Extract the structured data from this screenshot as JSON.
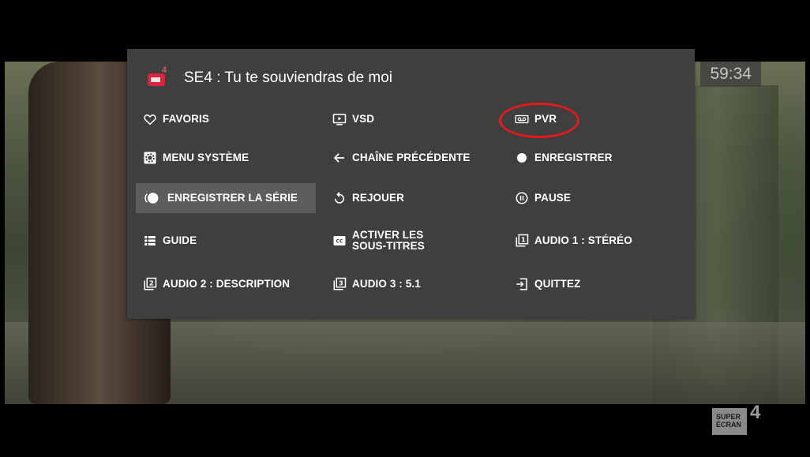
{
  "timecode": "59:34",
  "header": {
    "channel_badge_number": "4",
    "title": "SE4 : Tu te souviendras de moi"
  },
  "menu": {
    "items": [
      {
        "label": "FAVORIS",
        "icon": "heart-outline-icon"
      },
      {
        "label": "VSD",
        "icon": "play-screen-icon"
      },
      {
        "label": "PVR",
        "icon": "tape-icon"
      },
      {
        "label": "MENU SYSTÈME",
        "icon": "settings-box-icon"
      },
      {
        "label": "CHAÎNE PRÉCÉDENTE",
        "icon": "arrow-left-icon"
      },
      {
        "label": "ENREGISTRER",
        "icon": "record-dot-icon"
      },
      {
        "label": "ENREGISTRER LA SÉRIE",
        "icon": "series-record-icon"
      },
      {
        "label": "REJOUER",
        "icon": "replay-icon"
      },
      {
        "label": "PAUSE",
        "icon": "pause-circle-icon"
      },
      {
        "label": "GUIDE",
        "icon": "list-icon"
      },
      {
        "label": "ACTIVER LES\nSOUS-TITRES",
        "icon": "cc-icon"
      },
      {
        "label": "AUDIO 1 : STÉRÉO",
        "icon": "audio-1-icon"
      },
      {
        "label": "AUDIO 2 : DESCRIPTION",
        "icon": "audio-2-icon"
      },
      {
        "label": "AUDIO 3 : 5.1",
        "icon": "audio-3-icon"
      },
      {
        "label": "QUITTEZ",
        "icon": "exit-icon"
      }
    ],
    "selected_item": "ENREGISTRER LA SÉRIE",
    "highlighted_item": "PVR"
  },
  "watermark": {
    "line1": "SUPER",
    "line2": "ÉCRAN",
    "number": "4"
  },
  "colors": {
    "menu_bg": "#3f3f3f",
    "selected_bg": "#5d5d5d",
    "annotation_red": "#e01c1c",
    "channel_red": "#d7263d"
  }
}
